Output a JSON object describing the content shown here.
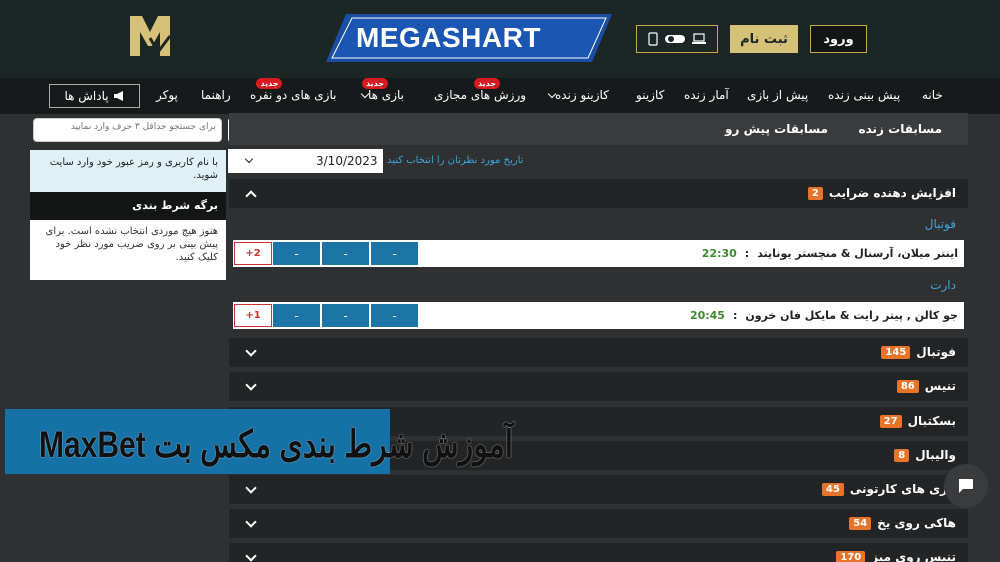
{
  "header": {
    "brand": "MEGASHART",
    "register_label": "ثبت نام",
    "login_label": "ورود"
  },
  "nav": {
    "items": [
      {
        "label": "خانه"
      },
      {
        "label": "پیش بینی زنده"
      },
      {
        "label": "پیش از بازی"
      },
      {
        "label": "آمار زنده"
      },
      {
        "label": "کازینو"
      },
      {
        "label": "کازینو زنده"
      },
      {
        "label": "ورزش های مجازی",
        "badge": "جدید"
      },
      {
        "label": "بازی ها",
        "badge": "جدید"
      },
      {
        "label": "بازی های دو نفره",
        "badge": "جدید"
      },
      {
        "label": "راهنما"
      },
      {
        "label": "پوکر"
      }
    ],
    "rewards_label": "پاداش ها"
  },
  "sidebar": {
    "search_placeholder": "برای جستجو حداقل ۳ حرف وارد نمایید",
    "login_notice": "با نام کاربری و رمز عبور خود وارد سایت شوید.",
    "betslip_title": "برگه شرط بندی",
    "betslip_empty": "هنوز هیچ موردی انتخاب نشده است. برای پیش بینی بر روی ضریب مورد نظر خود کلیک کنید."
  },
  "tabs": {
    "live": "مسابقات زنده",
    "prematch": "مسابقات پیش رو"
  },
  "date_filter": {
    "value": "3/10/2023",
    "label": "تاریخ مورد نظرتان را انتخاب کنید"
  },
  "boost": {
    "title": "افزایش دهنده ضرایب",
    "count": "2",
    "groups": [
      {
        "sport": "فوتبال",
        "match": "اینتر میلان، آرسنال & منچستر یونایتد",
        "time": "22:30",
        "odds": [
          "-",
          "-",
          "-"
        ],
        "more": "+2"
      },
      {
        "sport": "دارت",
        "match": "جو کالن , پیتر رایت & مایکل فان خرون",
        "time": "20:45",
        "odds": [
          "-",
          "-",
          "-"
        ],
        "more": "+1"
      }
    ]
  },
  "sports": [
    {
      "name": "فوتبال",
      "count": "145"
    },
    {
      "name": "تنیس",
      "count": "86"
    },
    {
      "name": "بسکتبال",
      "count": "27"
    },
    {
      "name": "والیبال",
      "count": "8"
    },
    {
      "name": "بازی های کارتونی",
      "count": "45"
    },
    {
      "name": "هاکی روی یخ",
      "count": "54"
    },
    {
      "name": "تنیس روی میز",
      "count": "170"
    }
  ],
  "banner": {
    "text": "آموزش شرط بندی مکس بت MaxBet"
  },
  "colors": {
    "accent_gold": "#d6c178",
    "odds_blue": "#1d74a6",
    "count_orange": "#e8742a",
    "new_badge_red": "#d71920"
  }
}
